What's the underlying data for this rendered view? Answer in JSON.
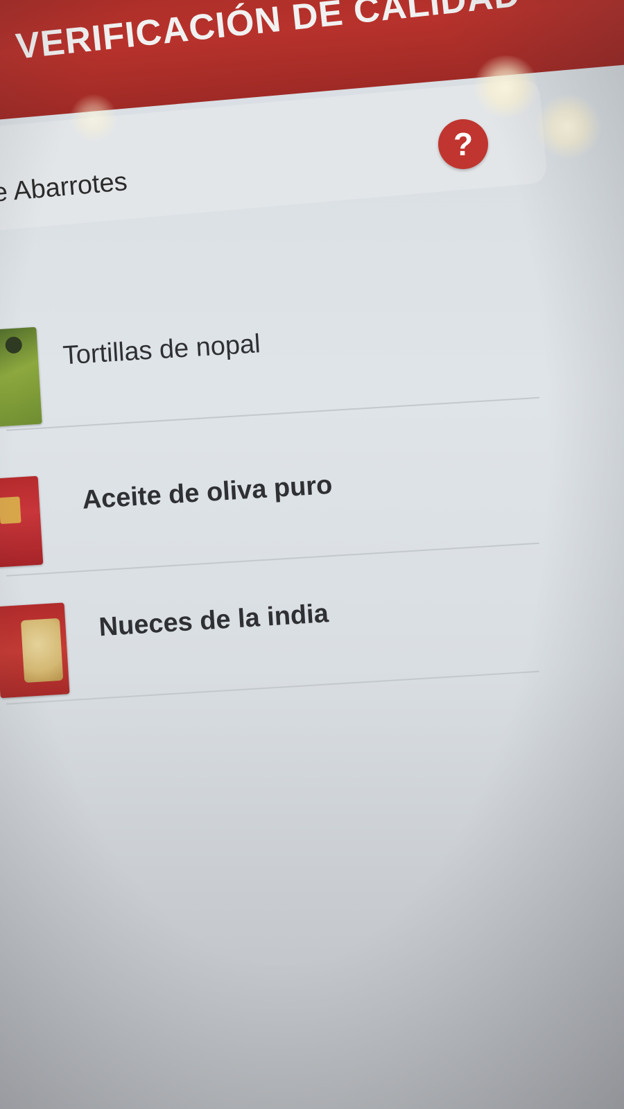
{
  "header": {
    "title": "VERIFICACIÓN DE CALIDAD",
    "background_color": "#b8322c"
  },
  "category": {
    "label": "e Abarrotes",
    "help_icon": "question-mark-icon",
    "help_symbol": "?"
  },
  "products": [
    {
      "name": "Tortillas de nopal",
      "thumbnail": "green-package"
    },
    {
      "name": "Aceite de oliva puro",
      "thumbnail": "red-package"
    },
    {
      "name": "Nueces de la india",
      "thumbnail": "cashew-package"
    }
  ]
}
